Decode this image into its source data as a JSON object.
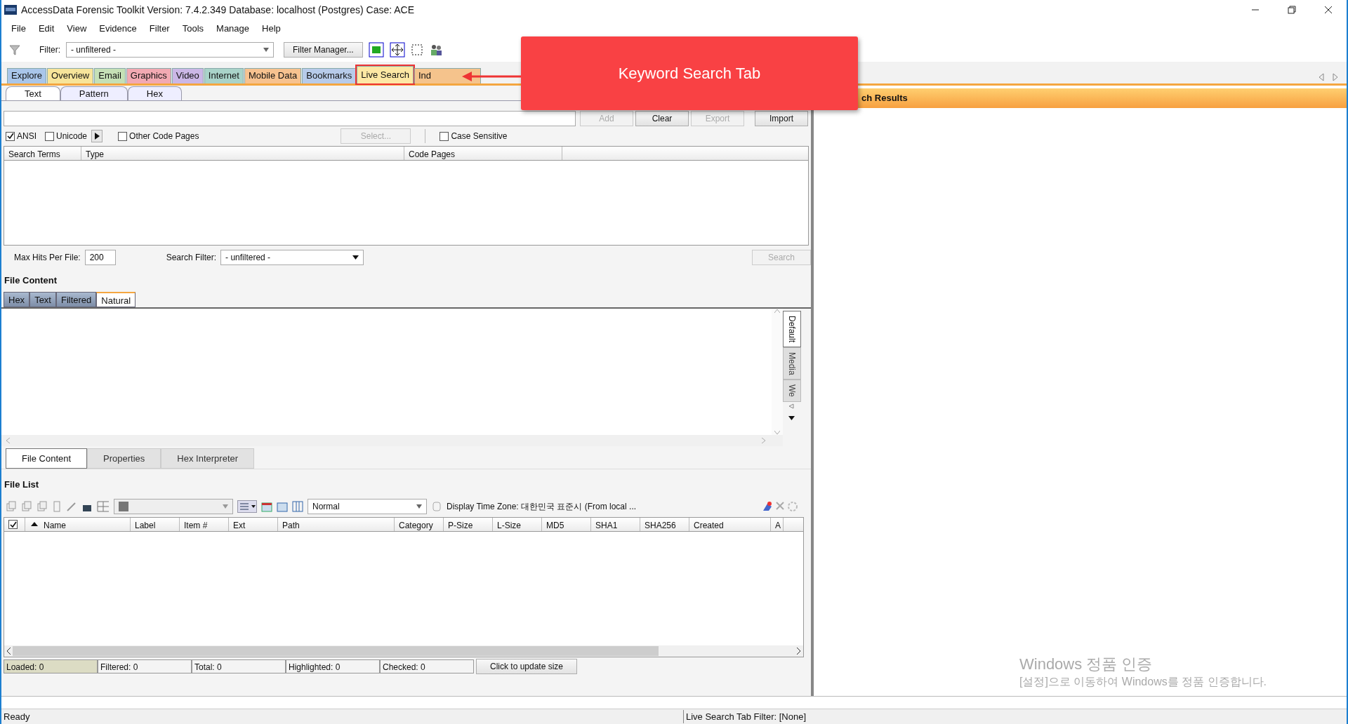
{
  "window": {
    "title": "AccessData Forensic Toolkit Version: 7.4.2.349 Database: localhost (Postgres) Case: ACE"
  },
  "menu": [
    "File",
    "Edit",
    "View",
    "Evidence",
    "Filter",
    "Tools",
    "Manage",
    "Help"
  ],
  "toolbar": {
    "filter_label": "Filter:",
    "filter_value": "- unfiltered -",
    "filter_manager": "Filter Manager..."
  },
  "main_tabs": [
    {
      "label": "Explore",
      "color": "#a9c6ea",
      "selected": false
    },
    {
      "label": "Overview",
      "color": "#f7e49a",
      "selected": false
    },
    {
      "label": "Email",
      "color": "#c5e0b6",
      "selected": false
    },
    {
      "label": "Graphics",
      "color": "#f2a9b2",
      "selected": false
    },
    {
      "label": "Video",
      "color": "#cbb7e6",
      "selected": false
    },
    {
      "label": "Internet",
      "color": "#a9d3c9",
      "selected": false
    },
    {
      "label": "Mobile Data",
      "color": "#f7c28f",
      "selected": false
    },
    {
      "label": "Bookmarks",
      "color": "#b7cbea",
      "selected": false
    },
    {
      "label": "Live Search",
      "color": "#fde8a4",
      "selected": true
    },
    {
      "label": "Ind",
      "color": "#f5c38c",
      "selected": false
    }
  ],
  "callout": {
    "text": "Keyword Search Tab"
  },
  "live_search": {
    "sub_tabs": [
      {
        "label": "Text",
        "selected": true
      },
      {
        "label": "Pattern",
        "selected": false
      },
      {
        "label": "Hex",
        "selected": false
      }
    ],
    "buttons": [
      {
        "label": "Add",
        "disabled": true
      },
      {
        "label": "Clear",
        "disabled": false
      },
      {
        "label": "Export",
        "disabled": true
      },
      {
        "label": "Import",
        "disabled": false
      }
    ],
    "checkboxes": [
      {
        "label": "ANSI",
        "checked": true
      },
      {
        "label": "Unicode",
        "checked": false
      },
      {
        "label": "Other Code Pages",
        "checked": false
      },
      {
        "label": "Case Sensitive",
        "checked": false
      }
    ],
    "select_button": {
      "label": "Select...",
      "disabled": true
    },
    "columns": [
      "Search Terms",
      "Type",
      "Code Pages"
    ],
    "max_hits_label": "Max Hits Per File:",
    "max_hits": "200",
    "search_filter_label": "Search Filter:",
    "search_filter": "- unfiltered -",
    "search_button": {
      "label": "Search",
      "disabled": true
    }
  },
  "file_content": {
    "title": "File Content",
    "view_tabs": [
      {
        "label": "Hex",
        "selected": false
      },
      {
        "label": "Text",
        "selected": false
      },
      {
        "label": "Filtered",
        "selected": false
      },
      {
        "label": "Natural",
        "selected": true
      }
    ],
    "side_tabs": [
      {
        "label": "Default",
        "selected": true
      },
      {
        "label": "Media",
        "selected": false
      },
      {
        "label": "We",
        "selected": false
      }
    ],
    "bottom_tabs": [
      {
        "label": "File Content",
        "selected": true
      },
      {
        "label": "Properties",
        "selected": false
      },
      {
        "label": "Hex Interpreter",
        "selected": false
      }
    ]
  },
  "file_list": {
    "title": "File List",
    "view_mode": "Normal",
    "time_zone": "Display Time Zone: 대한민국 표준시  (From local ...",
    "select_all_checked": true,
    "columns": [
      "Name",
      "Label",
      "Item #",
      "Ext",
      "Path",
      "Category",
      "P-Size",
      "L-Size",
      "MD5",
      "SHA1",
      "SHA256",
      "Created",
      "A"
    ],
    "counts": [
      {
        "label": "Loaded: 0",
        "selected": true
      },
      {
        "label": "Filtered: 0",
        "selected": false
      },
      {
        "label": "Total: 0",
        "selected": false
      },
      {
        "label": "Highlighted: 0",
        "selected": false
      },
      {
        "label": "Checked: 0",
        "selected": false
      }
    ],
    "update_button": "Click to update size"
  },
  "results": {
    "title": "ch Results"
  },
  "activation": {
    "title": "Windows 정품 인증",
    "text": "[설정]으로 이동하여 Windows를 정품 인증합니다."
  },
  "status_bar": {
    "left": "Ready",
    "right": "Live Search Tab Filter: [None]"
  }
}
